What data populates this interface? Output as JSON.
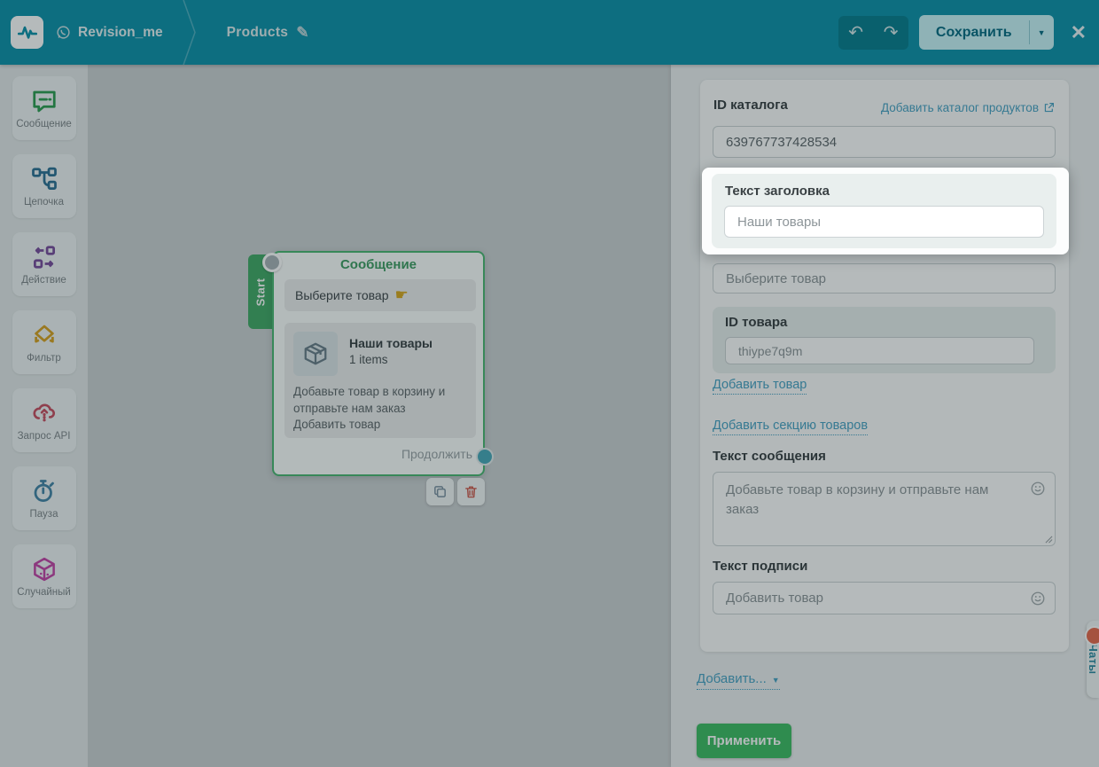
{
  "colors": {
    "accent_teal": "#0f92ab",
    "node_green": "#4db873",
    "apply_green": "#3fbd65",
    "link_blue": "#4aa3c4",
    "danger_red": "#cf5a4c",
    "section_bg": "#e9efee"
  },
  "header": {
    "bot_name": "Revision_me",
    "flow_name": "Products",
    "save_label": "Сохранить"
  },
  "icons": {
    "undo": "↶",
    "redo": "↷",
    "close": "✕",
    "pencil": "✎",
    "caret": "▼",
    "hand_pointer": "☛"
  },
  "sidebar": {
    "items": [
      {
        "label": "Сообщение",
        "icon": "message-icon"
      },
      {
        "label": "Цепочка",
        "icon": "chain-icon"
      },
      {
        "label": "Действие",
        "icon": "action-icon"
      },
      {
        "label": "Фильтр",
        "icon": "filter-icon"
      },
      {
        "label": "Запрос API",
        "icon": "api-request-icon"
      },
      {
        "label": "Пауза",
        "icon": "pause-icon"
      },
      {
        "label": "Случайный",
        "icon": "random-icon"
      }
    ]
  },
  "node": {
    "start_label": "Start",
    "title": "Сообщение",
    "bubble_text": "Выберите товар",
    "product_title": "Наши товары",
    "product_count": "1 items",
    "description_line1": "Добавьте товар в корзину и отправьте нам заказ",
    "description_line2": "Добавить товар",
    "continue_label": "Продолжить"
  },
  "panel": {
    "catalog_label": "ID каталога",
    "catalog_link": "Добавить каталог продуктов",
    "catalog_value": "639767737428534",
    "header_text_label": "Текст заголовка",
    "header_text_value": "Наши товары",
    "section_name_value": "Выберите товар",
    "product_id_label": "ID товара",
    "product_id_value": "thiype7q9m",
    "add_product_link": "Добавить товар",
    "add_section_link": "Добавить секцию товаров",
    "message_label": "Текст сообщения",
    "message_value": "Добавьте товар в корзину и отправьте нам заказ",
    "caption_label": "Текст подписи",
    "caption_value": "Добавить товар",
    "add_more_link": "Добавить...",
    "apply_label": "Применить"
  },
  "chat_tab": {
    "label": "Чаты"
  }
}
